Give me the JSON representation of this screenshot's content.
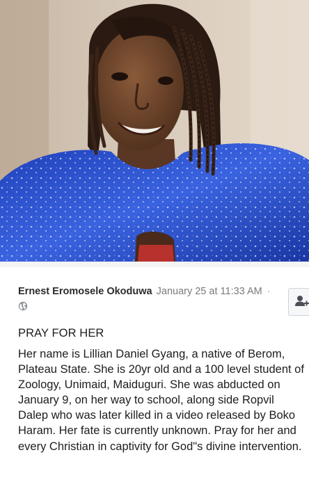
{
  "post": {
    "author": "Ernest Eromosele Okoduwa",
    "date": "January 25 at 11:33 AM",
    "separator": "·",
    "title": "PRAY FOR HER",
    "body": "Her name is Lillian Daniel Gyang, a native of Berom, Plateau State. She is 20yr old and a 100 level student of Zoology, Unimaid, Maiduguri. She was abducted on January 9, on her way to school, along side Ropvil Dalep who was later killed in a video released by Boko Haram. Her fate is currently unknown. Pray for her and every Christian in captivity for God\"s divine intervention."
  },
  "icons": {
    "privacy": "globe-icon",
    "add_friend": "add-friend-icon"
  },
  "colors": {
    "author_text": "#2b2b2b",
    "meta_text": "#7a7a7a",
    "body_text": "#1d1d1d",
    "dress_blue": "#2446c8"
  }
}
